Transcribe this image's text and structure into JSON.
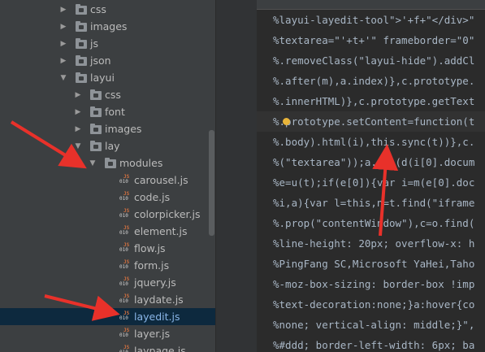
{
  "tree": {
    "items": [
      {
        "label": "css",
        "kind": "folder",
        "expanded": false
      },
      {
        "label": "images",
        "kind": "folder",
        "expanded": false
      },
      {
        "label": "js",
        "kind": "folder",
        "expanded": false
      },
      {
        "label": "json",
        "kind": "folder",
        "expanded": false
      },
      {
        "label": "layui",
        "kind": "folder",
        "expanded": true
      },
      {
        "label": "css",
        "kind": "folder",
        "expanded": false
      },
      {
        "label": "font",
        "kind": "folder",
        "expanded": false
      },
      {
        "label": "images",
        "kind": "folder",
        "expanded": false
      },
      {
        "label": "lay",
        "kind": "folder",
        "expanded": true
      },
      {
        "label": "modules",
        "kind": "folder",
        "expanded": true
      },
      {
        "label": "carousel.js",
        "kind": "file"
      },
      {
        "label": "code.js",
        "kind": "file"
      },
      {
        "label": "colorpicker.js",
        "kind": "file"
      },
      {
        "label": "element.js",
        "kind": "file"
      },
      {
        "label": "flow.js",
        "kind": "file"
      },
      {
        "label": "form.js",
        "kind": "file"
      },
      {
        "label": "jquery.js",
        "kind": "file"
      },
      {
        "label": "laydate.js",
        "kind": "file"
      },
      {
        "label": "layedit.js",
        "kind": "file",
        "selected": true
      },
      {
        "label": "layer.js",
        "kind": "file"
      },
      {
        "label": "laypage.js",
        "kind": "file"
      }
    ],
    "file_icon_text": {
      "js": "JS",
      "bin": "010"
    }
  },
  "editor": {
    "lines": [
      "%layui-layedit-tool\">'+f+\"</div>\"",
      "%textarea=\"'+t+'\" frameborder=\"0\"",
      "%.removeClass(\"layui-hide\").addCl",
      "%.after(m),a.index)},c.prototype.",
      "%.innerHTML)},c.prototype.getText",
      "%.prototype.setContent=function(t",
      "%.body).html(i),this.sync(t))},c.",
      "%(\"textarea\"));a.val(d(i[0].docum",
      "%e=u(t);if(e[0]){var i=m(e[0].doc",
      "%i,a){var l=this,n=t.find(\"iframe",
      "%.prop(\"contentWindow\"),c=o.find(",
      "%line-height: 20px; overflow-x: h",
      "%PingFang SC,Microsoft YaHei,Taho",
      "%-moz-box-sizing: border-box !imp",
      "%text-decoration:none;}a:hover{co",
      "%none; vertical-align: middle;}\",",
      "%#ddd; border-left-width: 6px; ba"
    ]
  },
  "colors": {
    "arrow": "#e8312a",
    "tree_bg": "#3c3f41",
    "editor_bg": "#2b2b2b",
    "selection": "#0d293e"
  }
}
